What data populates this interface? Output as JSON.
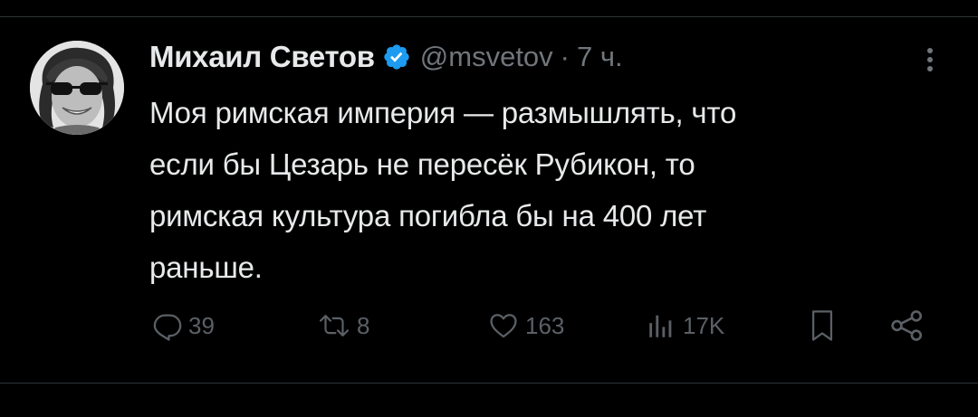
{
  "tweet": {
    "author": {
      "display_name": "Михаил Светов",
      "handle": "@msvetov",
      "verified": true,
      "avatar_icon": "profile-photo-man-with-sunglasses"
    },
    "separator": "·",
    "timestamp": "7 ч.",
    "text_lines": [
      "Моя римская империя — размышлять, что",
      "если бы Цезарь не пересёк Рубикон, то",
      "римская культура погибла бы на 400 лет",
      "раньше."
    ],
    "actions": {
      "reply": {
        "icon": "reply-icon",
        "count": "39"
      },
      "retweet": {
        "icon": "retweet-icon",
        "count": "8"
      },
      "like": {
        "icon": "heart-icon",
        "count": "163"
      },
      "views": {
        "icon": "views-chart-icon",
        "count": "17K"
      },
      "bookmark": {
        "icon": "bookmark-icon"
      },
      "share": {
        "icon": "share-icon"
      }
    }
  },
  "colors": {
    "background": "#000000",
    "text_primary": "#e7e9ea",
    "text_secondary": "#71767b",
    "action_icons": "#5b6066",
    "verified_badge": "#1d9bf0",
    "divider": "#2f3336"
  }
}
